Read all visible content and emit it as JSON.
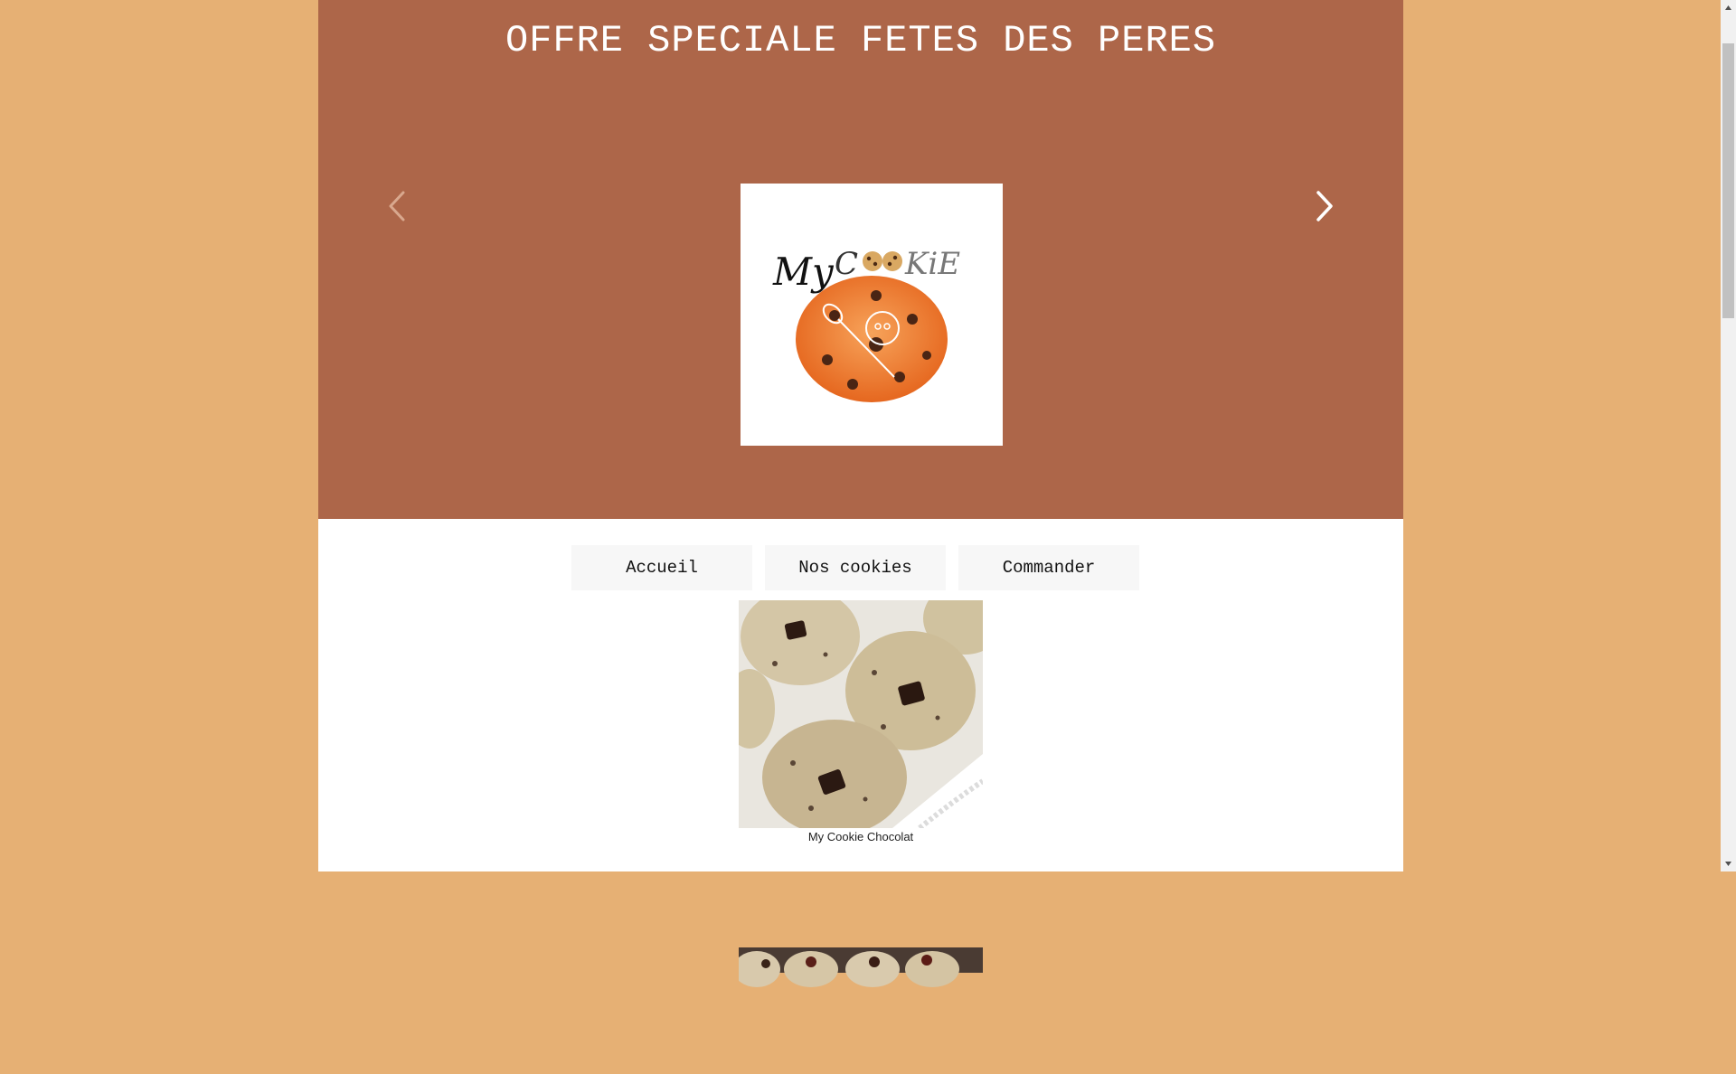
{
  "banner": {
    "title": "OFFRE SPECIALE FETES DES PERES",
    "prev_icon": "chevron-left-icon",
    "next_icon": "chevron-right-icon",
    "slide": {
      "logo_text": "My CooKiE"
    }
  },
  "nav": {
    "items": [
      {
        "label": "Accueil"
      },
      {
        "label": "Nos cookies"
      },
      {
        "label": "Commander"
      }
    ]
  },
  "products": [
    {
      "caption": "My Cookie Chocolat"
    }
  ],
  "colors": {
    "page_background": "#e6b074",
    "banner_background": "#ad6649",
    "content_background": "#ffffff",
    "nav_button_background": "#f7f7f7"
  }
}
